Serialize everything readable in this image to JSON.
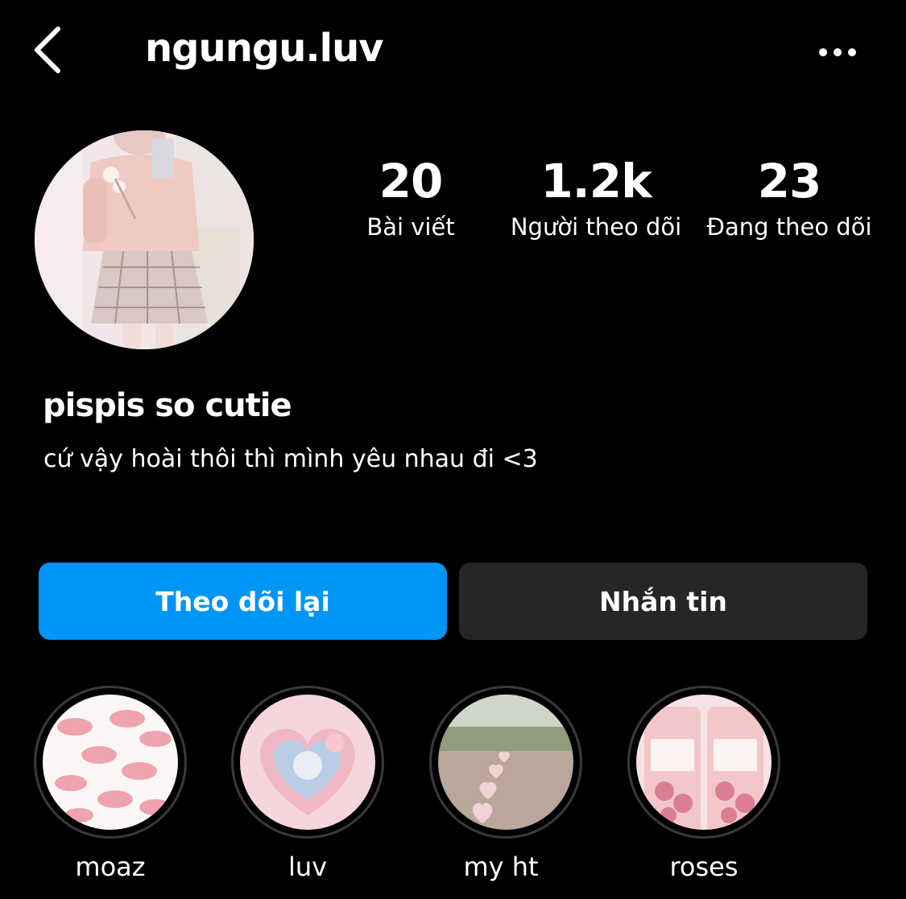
{
  "header": {
    "username": "ngungu.luv",
    "back_icon": "chevron-left-icon",
    "more_icon": "more-horizontal-icon"
  },
  "stats": {
    "posts": {
      "value": "20",
      "label": "Bài viết"
    },
    "followers": {
      "value": "1.2k",
      "label": "Người theo dõi"
    },
    "following": {
      "value": "23",
      "label": "Đang theo dõi"
    }
  },
  "profile": {
    "display_name": "pispis so cutie",
    "bio": "cứ vậy hoài thôi thì mình yêu nhau đi <3"
  },
  "actions": {
    "follow_back_label": "Theo dõi lại",
    "message_label": "Nhắn tin"
  },
  "highlights": [
    {
      "label": "moaz"
    },
    {
      "label": "luv"
    },
    {
      "label": "my ht"
    },
    {
      "label": "roses"
    }
  ],
  "colors": {
    "background": "#000000",
    "primary_button": "#0095f6",
    "secondary_button": "#262626",
    "text": "#ffffff"
  }
}
